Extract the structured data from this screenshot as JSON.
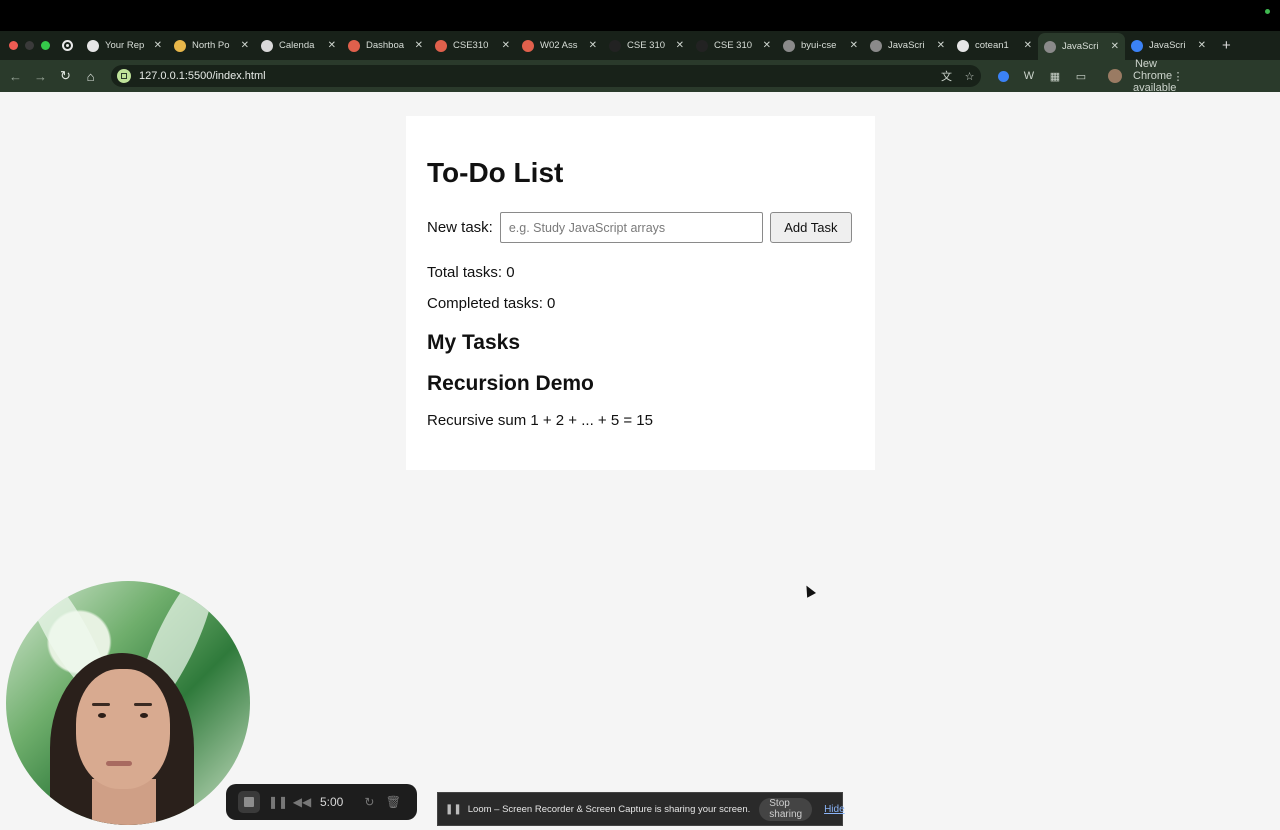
{
  "browser": {
    "tabs": [
      {
        "title": "Your Rep",
        "icon": "github-icon",
        "color": "#e6e6e6"
      },
      {
        "title": "North Po",
        "icon": "docs-icon",
        "color": "#e8b74a"
      },
      {
        "title": "Calenda",
        "icon": "calendar-icon",
        "color": "#d9d9d9"
      },
      {
        "title": "Dashboa",
        "icon": "canvas-icon",
        "color": "#e0604c"
      },
      {
        "title": "CSE310",
        "icon": "canvas-icon",
        "color": "#e0604c"
      },
      {
        "title": "W02 Ass",
        "icon": "canvas-icon",
        "color": "#e0604c"
      },
      {
        "title": "CSE 310",
        "icon": "page-icon",
        "color": "#222222"
      },
      {
        "title": "CSE 310",
        "icon": "page-icon",
        "color": "#222222"
      },
      {
        "title": "byui-cse",
        "icon": "globe-icon",
        "color": "#8a8a8a"
      },
      {
        "title": "JavaScri",
        "icon": "globe-icon",
        "color": "#8a8a8a"
      },
      {
        "title": "cotean1",
        "icon": "github-icon",
        "color": "#e6e6e6"
      },
      {
        "title": "JavaScri",
        "icon": "globe-icon",
        "color": "#8a8a8a",
        "active": true
      },
      {
        "title": "JavaScri",
        "icon": "chrome-icon",
        "color": "#3b82f6"
      }
    ],
    "new_tab_label": "+",
    "url": "127.0.0.1:5500/index.html",
    "update_label": "New Chrome available"
  },
  "page": {
    "title": "To-Do List",
    "new_task_label": "New task:",
    "input_placeholder": "e.g. Study JavaScript arrays",
    "input_value": "",
    "add_button_label": "Add Task",
    "total_tasks": "Total tasks: 0",
    "completed_tasks": "Completed tasks: 0",
    "my_tasks_heading": "My Tasks",
    "recursion_heading": "Recursion Demo",
    "recursion_result": "Recursive sum 1 + 2 + ... + 5 = 15"
  },
  "loom": {
    "timer": "5:00",
    "sharing_message": "Loom – Screen Recorder & Screen Capture is sharing your screen.",
    "stop_sharing_label": "Stop sharing",
    "hide_label": "Hide"
  }
}
